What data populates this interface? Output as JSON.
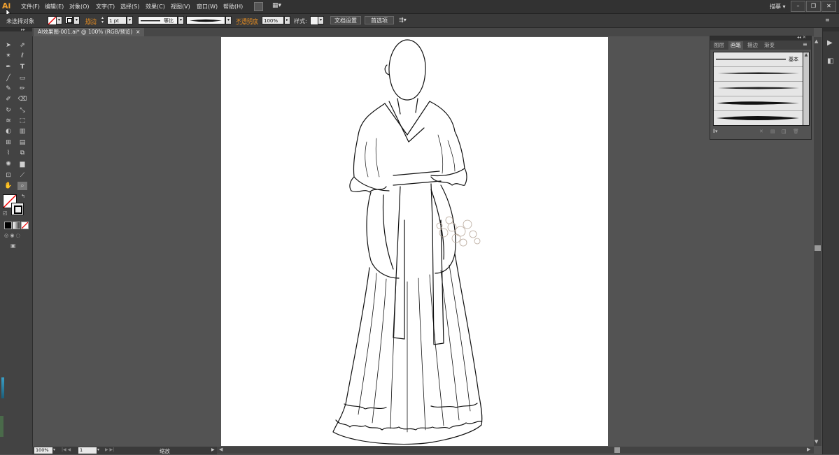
{
  "app": {
    "logo": "Ai"
  },
  "menu": [
    "文件(F)",
    "编辑(E)",
    "对象(O)",
    "文字(T)",
    "选择(S)",
    "效果(C)",
    "视图(V)",
    "窗口(W)",
    "帮助(H)"
  ],
  "workspace": "描摹",
  "window_controls": {
    "minimize": "–",
    "restore": "❐",
    "close": "✕"
  },
  "control_bar": {
    "selection_status": "未选择对象",
    "stroke_label": "描边",
    "stroke_weight": "1 pt",
    "profile_label": "等比",
    "opacity_label": "不透明度",
    "opacity_value": "100%",
    "style_label": "样式:",
    "doc_setup_button": "文档设置",
    "preferences_button": "首选项"
  },
  "document_tab": {
    "title": "AI效果图-001.ai* @ 100% (RGB/预览)",
    "close": "×"
  },
  "brush_panel": {
    "tabs": [
      "图层",
      "画笔",
      "描边",
      "渐变"
    ],
    "active_tab": "画笔",
    "basic_label": "基本"
  },
  "status_bar": {
    "zoom": "100%",
    "artboard_number": "1",
    "status_text": "缩放"
  },
  "colors": {
    "accent_orange": "#e88e22",
    "menubar": "#323232",
    "pasteboard": "#535353",
    "artboard": "#ffffff"
  }
}
